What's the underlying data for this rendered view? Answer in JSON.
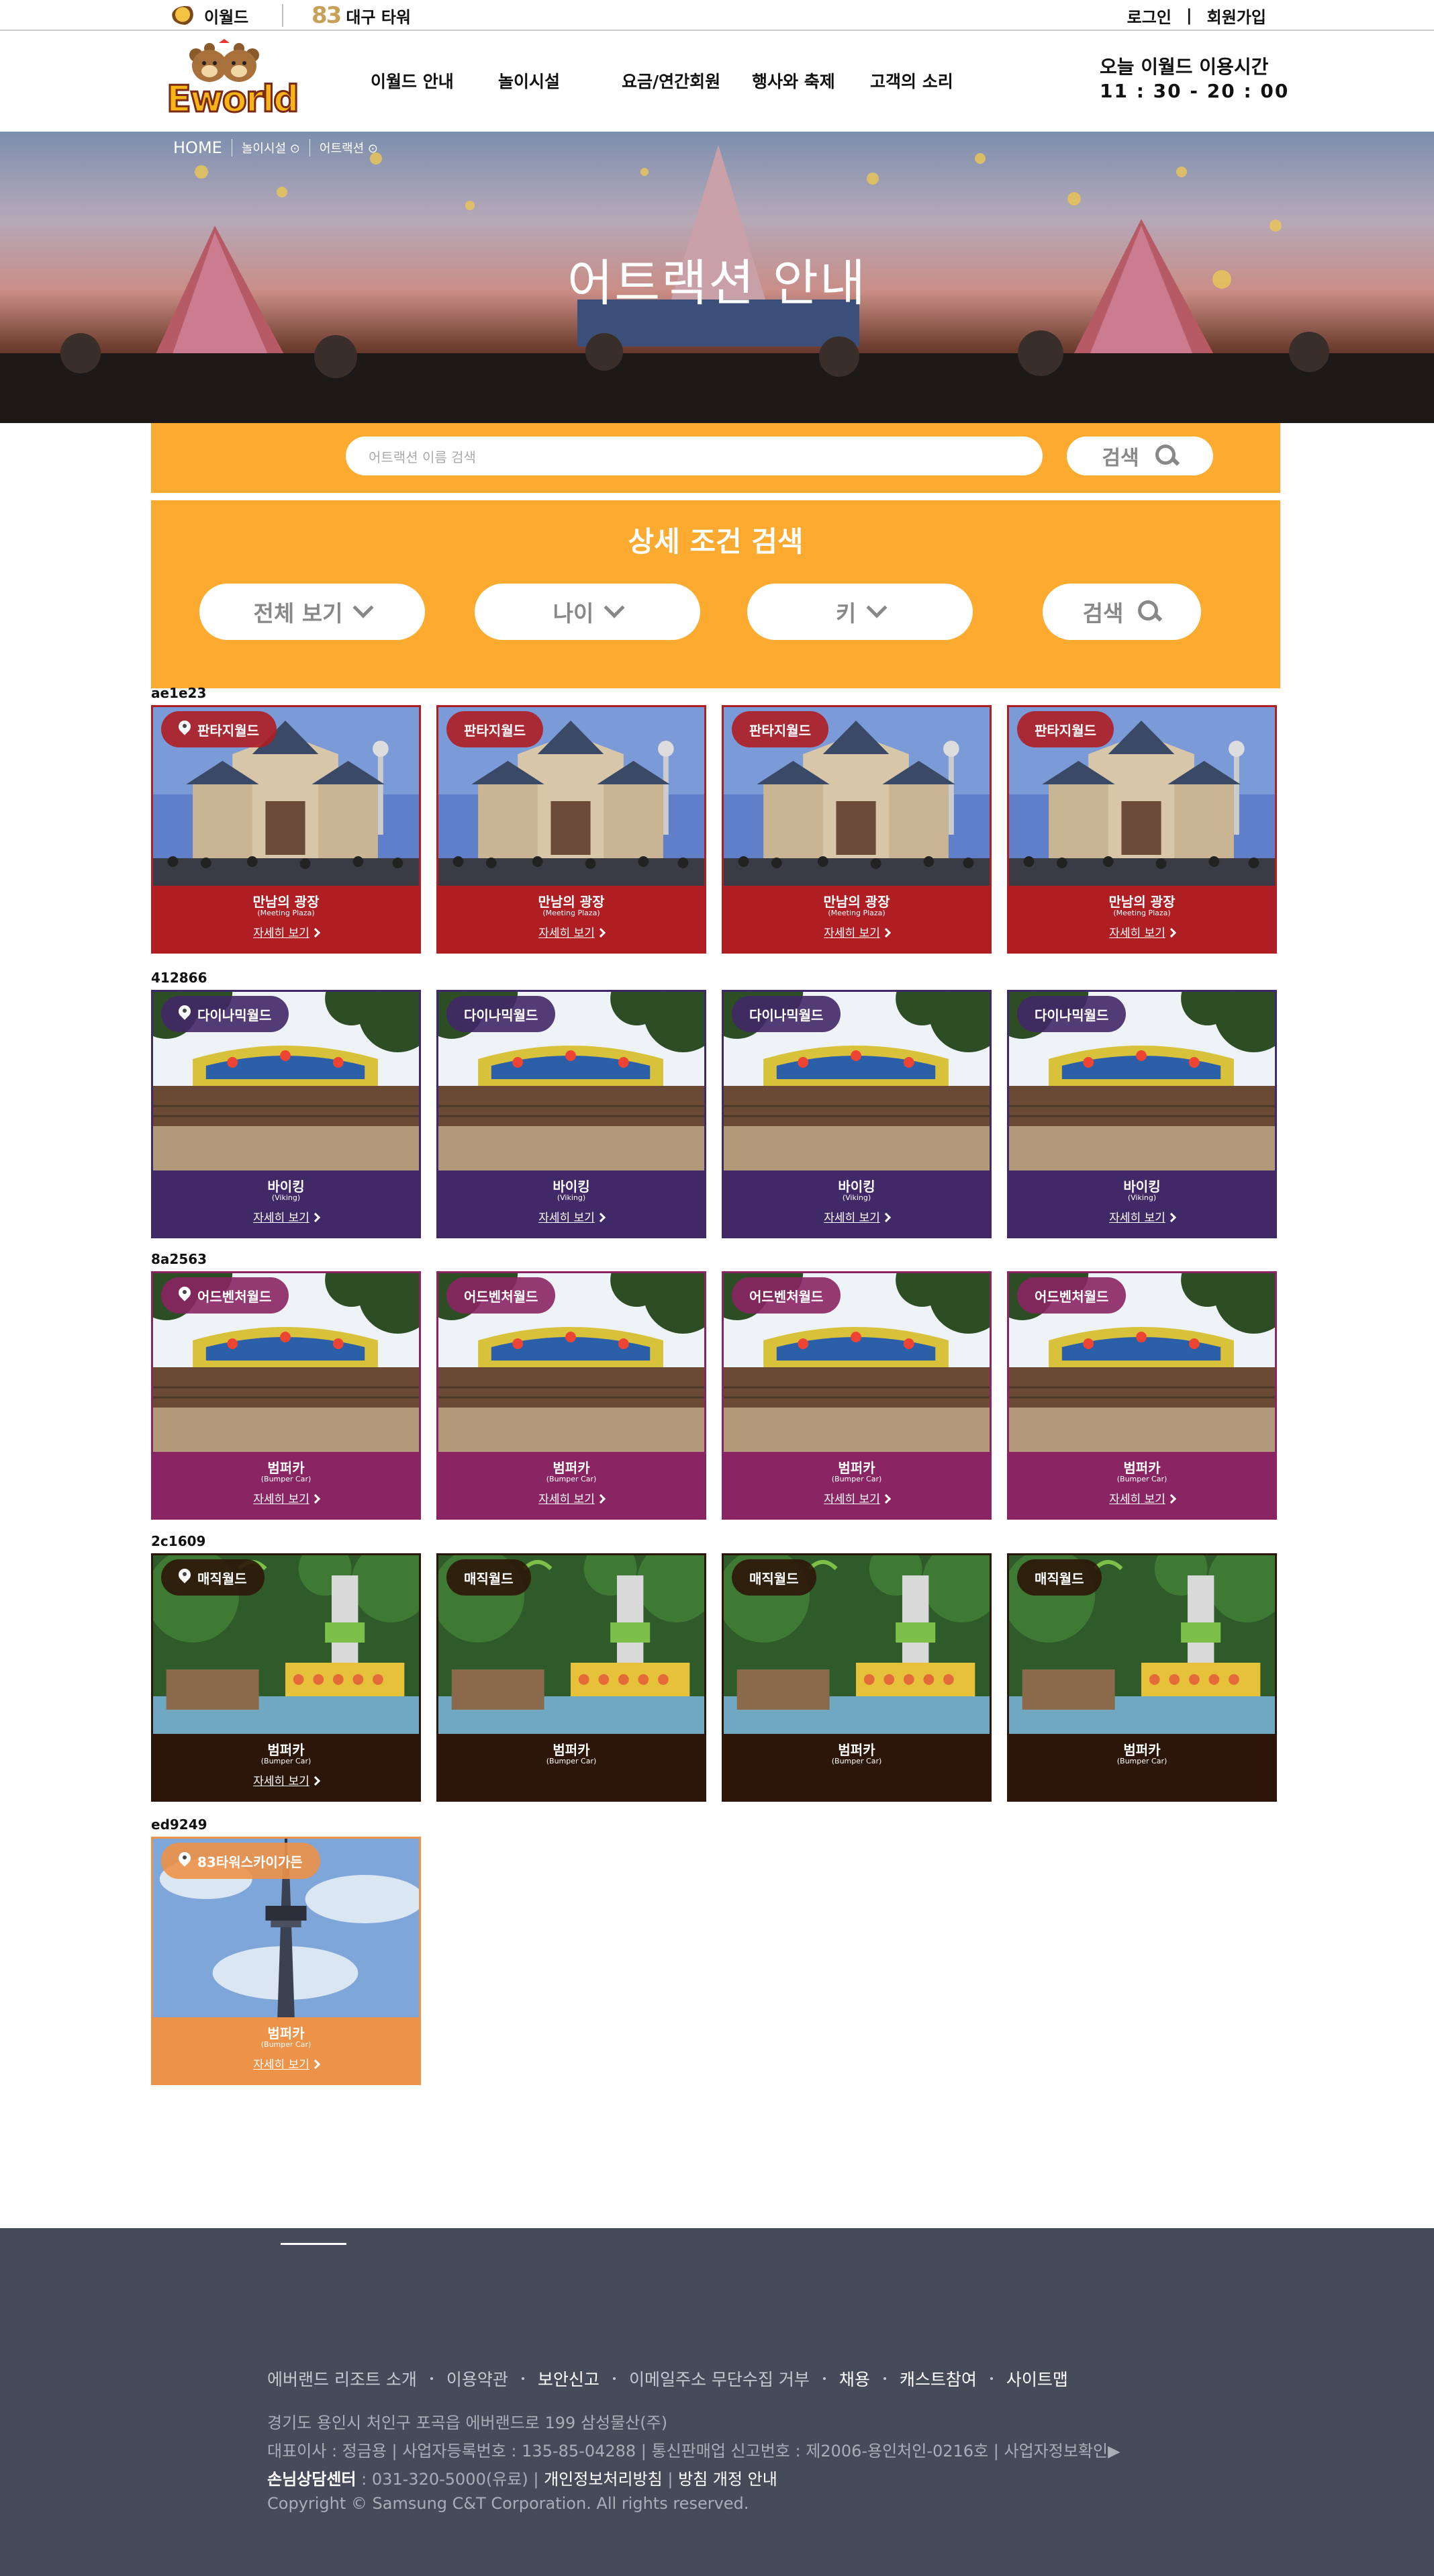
{
  "topbar": {
    "eworld": "이월드",
    "tower": "대구 타워",
    "tower_num": "83",
    "login": "로그인",
    "divider": "|",
    "signup": "회원가입"
  },
  "header": {
    "logo_text": "Eworld",
    "nav": [
      "이월드 안내",
      "놀이시설",
      "요금/연간회원",
      "행사와 축제",
      "고객의 소리"
    ],
    "hours_label": "오늘 이월드 이용시간",
    "hours_value": "11 : 30 - 20 : 00"
  },
  "breadcrumb": [
    "HOME",
    "놀이시설",
    "어트랙션"
  ],
  "hero_title": "어트랙션 안내",
  "search": {
    "placeholder": "어트랙션 이름 검색",
    "button": "검색"
  },
  "detail": {
    "title": "상세 조건 검색",
    "filters": [
      "전체 보기",
      "나이",
      "키"
    ],
    "button": "검색"
  },
  "groups": [
    {
      "label": "ae1e23",
      "color": "#ae1e23",
      "zone": "판타지월드",
      "name": "만남의 광장",
      "sub": "(Meeting Plaza)",
      "more": "자세히 보기",
      "photo": "castle",
      "show_more": [
        true,
        true,
        true,
        true
      ]
    },
    {
      "label": "412866",
      "color": "#412866",
      "zone": "다이나믹월드",
      "name": "바이킹",
      "sub": "(Viking)",
      "more": "자세히 보기",
      "photo": "ride",
      "show_more": [
        true,
        true,
        true,
        true
      ]
    },
    {
      "label": "8a2563",
      "color": "#8a2563",
      "zone": "어드벤처월드",
      "name": "범퍼카",
      "sub": "(Bumper Car)",
      "more": "자세히 보기",
      "photo": "ride",
      "show_more": [
        true,
        true,
        true,
        true
      ]
    },
    {
      "label": "2c1609",
      "color": "#2c1609",
      "zone": "매직월드",
      "name": "범퍼카",
      "sub": "(Bumper Car)",
      "more": "자세히 보기",
      "photo": "drop",
      "show_more": [
        true,
        false,
        false,
        false
      ]
    },
    {
      "label": "ed9249",
      "color": "#ed9249",
      "zone": "83타워스카이가든",
      "name": "범퍼카",
      "sub": "(Bumper Car)",
      "more": "자세히 보기",
      "photo": "tower",
      "show_more": [
        true
      ]
    }
  ],
  "footer": {
    "links": [
      "에버랜드 리조트 소개",
      "이용약관",
      "보안신고",
      "이메일주소 무단수집 거부",
      "채용",
      "캐스트참여",
      "사이트맵"
    ],
    "address": "경기도 용인시 처인구 포곡읍 에버랜드로 199 삼성물산(주)",
    "biz": "대표이사 : 정금용 | 사업자등록번호 : 135-85-04288 | 통신판매업 신고번호 : 제2006-용인처인-0216호 | 사업자정보확인▶",
    "cs_label": "손님상담센터",
    "cs_number": " : 031-320-5000(유료) | ",
    "privacy": "개인정보처리방침",
    "privacy_sep": " | ",
    "notice": "방침 개정 안내",
    "copyright": "Copyright © Samsung C&T Corporation. All rights reserved."
  }
}
